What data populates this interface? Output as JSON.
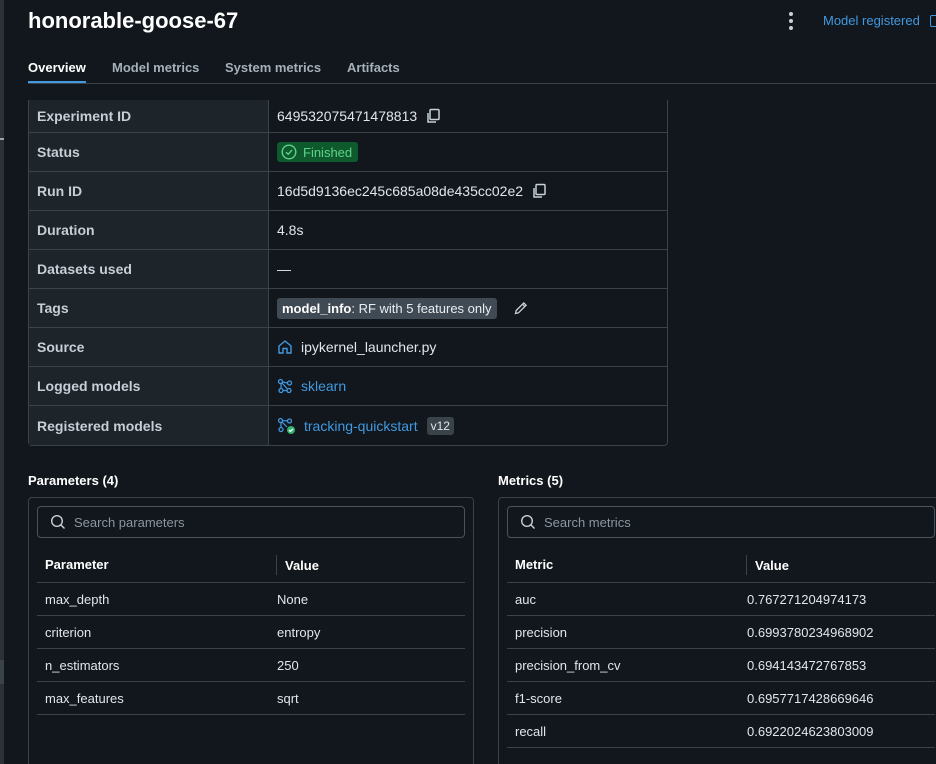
{
  "run": {
    "title": "honorable-goose-67",
    "model_registered_label": "Model registered"
  },
  "tabs": [
    {
      "label": "Overview",
      "active": true
    },
    {
      "label": "Model metrics",
      "active": false
    },
    {
      "label": "System metrics",
      "active": false
    },
    {
      "label": "Artifacts",
      "active": false
    }
  ],
  "overview": {
    "experiment_id": {
      "label": "Experiment ID",
      "value": "649532075471478813"
    },
    "status": {
      "label": "Status",
      "value": "Finished"
    },
    "run_id": {
      "label": "Run ID",
      "value": "16d5d9136ec245c685a08de435cc02e2"
    },
    "duration": {
      "label": "Duration",
      "value": "4.8s"
    },
    "datasets": {
      "label": "Datasets used",
      "value": "—"
    },
    "tags": {
      "label": "Tags",
      "tag_key": "model_info",
      "tag_value": ": RF with 5 features only"
    },
    "source": {
      "label": "Source",
      "value": "ipykernel_launcher.py"
    },
    "logged_models": {
      "label": "Logged models",
      "value": "sklearn"
    },
    "registered_models": {
      "label": "Registered models",
      "value": "tracking-quickstart",
      "version": "v12"
    }
  },
  "parameters": {
    "title": "Parameters (4)",
    "search_placeholder": "Search parameters",
    "col_name": "Parameter",
    "col_value": "Value",
    "rows": [
      {
        "name": "max_depth",
        "value": "None"
      },
      {
        "name": "criterion",
        "value": "entropy"
      },
      {
        "name": "n_estimators",
        "value": "250"
      },
      {
        "name": "max_features",
        "value": "sqrt"
      }
    ]
  },
  "metrics": {
    "title": "Metrics (5)",
    "search_placeholder": "Search metrics",
    "col_name": "Metric",
    "col_value": "Value",
    "rows": [
      {
        "name": "auc",
        "value": "0.767271204974173"
      },
      {
        "name": "precision",
        "value": "0.6993780234968902"
      },
      {
        "name": "precision_from_cv",
        "value": "0.694143472767853"
      },
      {
        "name": "f1-score",
        "value": "0.6957717428669646"
      },
      {
        "name": "recall",
        "value": "0.6922024623803009"
      }
    ]
  },
  "colors": {
    "background": "#11171c",
    "accent": "#4299e0",
    "status_bg": "#0f5a2d",
    "status_fg": "#5ed28a"
  }
}
